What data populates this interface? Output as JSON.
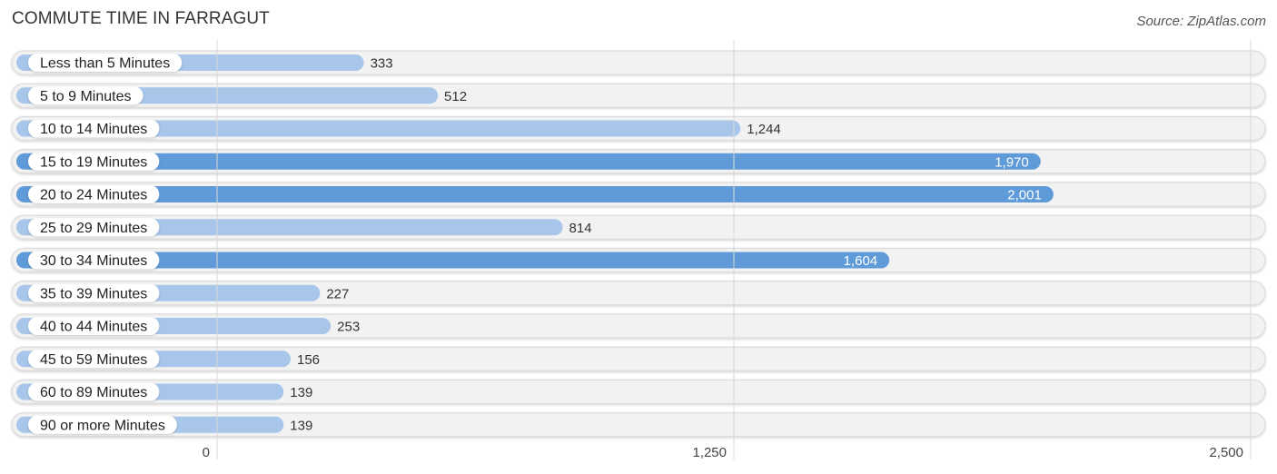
{
  "header": {
    "title": "COMMUTE TIME IN FARRAGUT",
    "source": "Source: ZipAtlas.com"
  },
  "chart_data": {
    "type": "bar",
    "orientation": "horizontal",
    "title": "COMMUTE TIME IN FARRAGUT",
    "xlabel": "",
    "ylabel": "",
    "xlim": [
      0,
      2500
    ],
    "x_ticks": [
      0,
      1250,
      2500
    ],
    "x_tick_labels": [
      "0",
      "1,250",
      "2,500"
    ],
    "grid": true,
    "categories": [
      "Less than 5 Minutes",
      "5 to 9 Minutes",
      "10 to 14 Minutes",
      "15 to 19 Minutes",
      "20 to 24 Minutes",
      "25 to 29 Minutes",
      "30 to 34 Minutes",
      "35 to 39 Minutes",
      "40 to 44 Minutes",
      "45 to 59 Minutes",
      "60 to 89 Minutes",
      "90 or more Minutes"
    ],
    "values": [
      333,
      512,
      1244,
      1970,
      2001,
      814,
      1604,
      227,
      253,
      156,
      139,
      139
    ],
    "value_labels": [
      "333",
      "512",
      "1,244",
      "1,970",
      "2,001",
      "814",
      "1,604",
      "227",
      "253",
      "156",
      "139",
      "139"
    ],
    "colors": {
      "bar_light": "#a7c6ea",
      "bar_strong": "#5f9ad9",
      "track": "#f2f2f2",
      "track_border": "#dcdcdc"
    }
  }
}
